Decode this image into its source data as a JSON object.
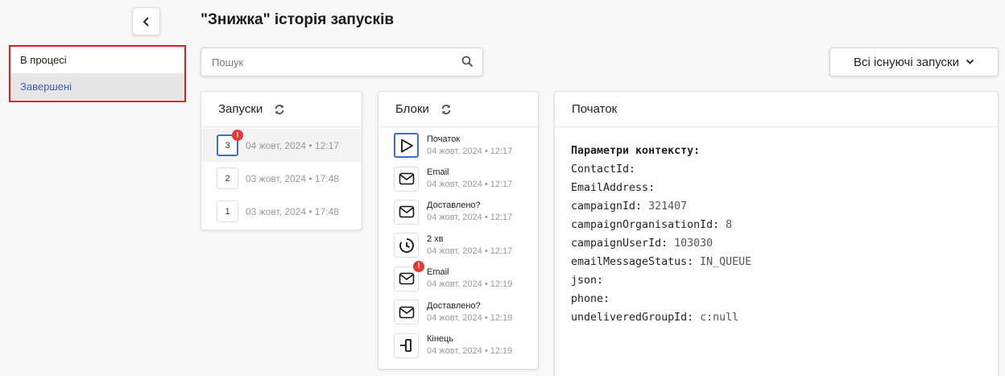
{
  "page_title": "\"Знижка\" історія запусків",
  "sidebar": {
    "items": [
      {
        "label": "В процесі",
        "active": false
      },
      {
        "label": "Завершені",
        "active": true
      }
    ]
  },
  "search": {
    "placeholder": "Пошук",
    "value": ""
  },
  "runs_filter": {
    "label": "Всі існуючі запуски"
  },
  "runs_panel": {
    "title": "Запуски",
    "items": [
      {
        "number": "3",
        "date": "04 жовт, 2024 • 12:17",
        "active": true,
        "error": true
      },
      {
        "number": "2",
        "date": "03 жовт, 2024 • 17:48",
        "active": false,
        "error": false
      },
      {
        "number": "1",
        "date": "03 жовт, 2024 • 17:48",
        "active": false,
        "error": false
      }
    ]
  },
  "blocks_panel": {
    "title": "Блоки",
    "items": [
      {
        "icon": "play-icon",
        "name": "Початок",
        "date": "04 жовт, 2024 • 12:17",
        "active": true,
        "error": false
      },
      {
        "icon": "email-icon",
        "name": "Email",
        "date": "04 жовт, 2024 • 12:17",
        "active": false,
        "error": false
      },
      {
        "icon": "email-icon",
        "name": "Доставлено?",
        "date": "04 жовт, 2024 • 12:17",
        "active": false,
        "error": false
      },
      {
        "icon": "timer-icon",
        "name": "2 хв",
        "date": "04 жовт, 2024 • 12:17",
        "active": false,
        "error": false
      },
      {
        "icon": "email-icon",
        "name": "Email",
        "date": "04 жовт, 2024 • 12:19",
        "active": false,
        "error": true
      },
      {
        "icon": "email-icon",
        "name": "Доставлено?",
        "date": "04 жовт, 2024 • 12:19",
        "active": false,
        "error": false
      },
      {
        "icon": "end-icon",
        "name": "Кінець",
        "date": "04 жовт, 2024 • 12:19",
        "active": false,
        "error": false
      }
    ]
  },
  "detail_panel": {
    "title": "Початок",
    "context_title": "Параметри контексту:",
    "params": [
      {
        "key": "ContactId:",
        "value": ""
      },
      {
        "key": "EmailAddress:",
        "value": ""
      },
      {
        "key": "campaignId:",
        "value": "321407"
      },
      {
        "key": "campaignOrganisationId:",
        "value": "8"
      },
      {
        "key": "campaignUserId:",
        "value": "103030"
      },
      {
        "key": "emailMessageStatus:",
        "value": "IN_QUEUE"
      },
      {
        "key": "json:",
        "value": ""
      },
      {
        "key": "phone:",
        "value": ""
      },
      {
        "key": "undeliveredGroupId:",
        "value": "c:null"
      }
    ]
  },
  "colors": {
    "accent": "#3b6fd6",
    "error": "#e53935",
    "highlight_border": "#e01b24",
    "active_link": "#3b5bcc"
  }
}
